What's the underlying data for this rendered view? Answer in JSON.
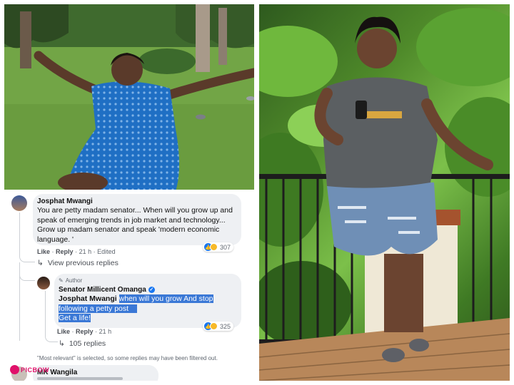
{
  "comments": [
    {
      "author": "Josphat Mwangi",
      "text": "You are petty madam senator... When will you grow up and speak of emerging trends in job market and technology... Grow up madam senator and speak 'modern economic language. '",
      "actions": {
        "like": "Like",
        "reply": "Reply",
        "time": "21 h",
        "edited": "Edited"
      },
      "reaction_count": "307",
      "view_previous": "View previous replies"
    },
    {
      "badge": "Author",
      "author": "Senator Millicent Omanga",
      "mention": "Josphat Mwangi",
      "text_line1": "when will you grow And stop",
      "text_line2": "following a petty post",
      "text_line3": "Get a life!",
      "actions": {
        "like": "Like",
        "reply": "Reply",
        "time": "21 h"
      },
      "reaction_count": "325",
      "replies_link": "105 replies"
    }
  ],
  "filter_note": "\"Most relevant\" is selected, so some replies may have been filtered out.",
  "next_comment_author": "MK Wangila",
  "watermark": "PICBOW",
  "icons": {
    "like": "like-reaction-icon",
    "haha": "haha-reaction-icon",
    "reply_arrow": "reply-arrow-icon",
    "verified": "verified-badge-icon"
  },
  "colors": {
    "highlight": "#3a78d6",
    "like_blue": "#1877f2",
    "bubble": "#eef0f3"
  }
}
